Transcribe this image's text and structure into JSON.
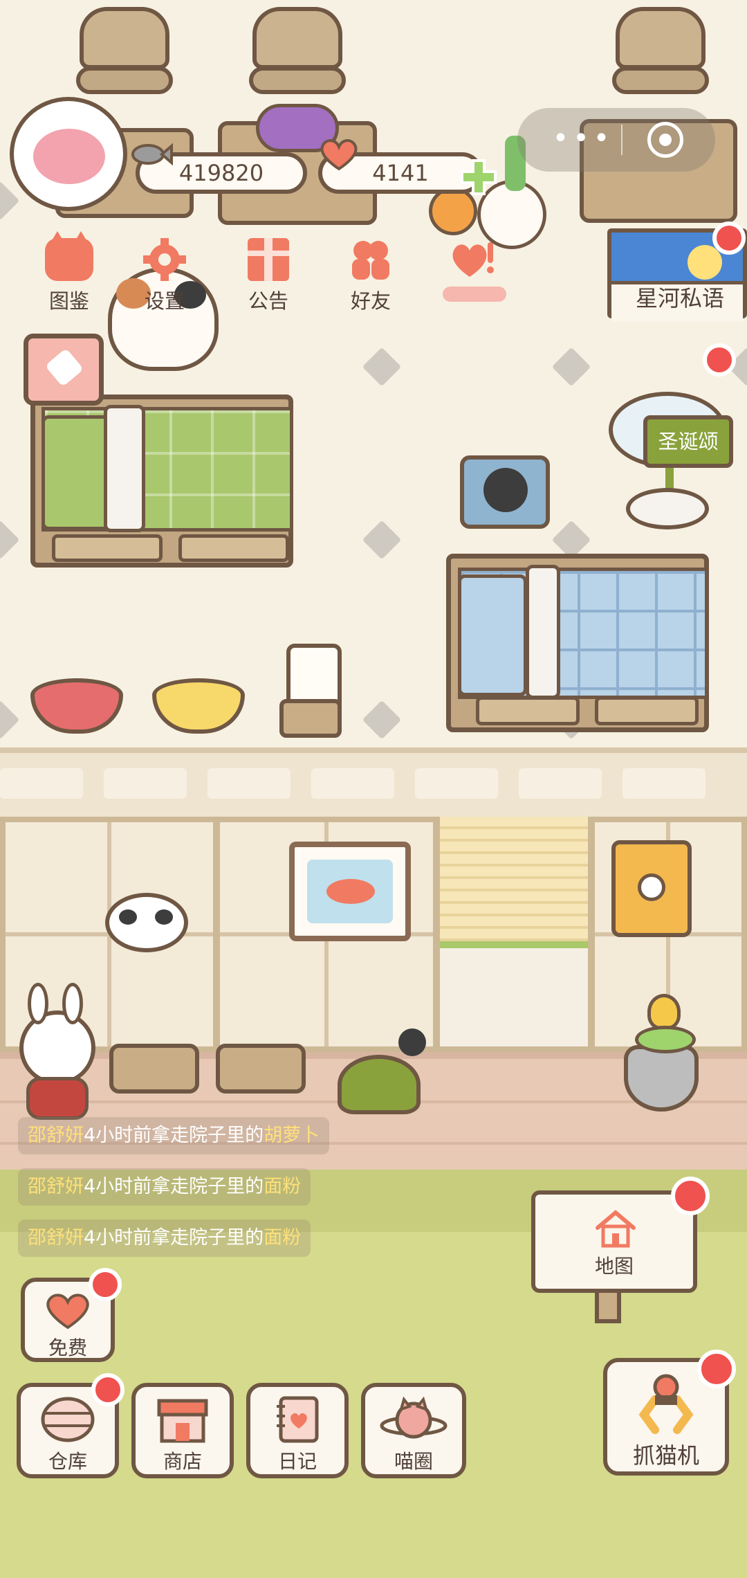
{
  "hud": {
    "avatar_icon": "cat-avatar-icon",
    "coins": {
      "value": "419820",
      "icon": "fish-icon"
    },
    "hearts": {
      "value": "4141",
      "icon": "heart-icon"
    },
    "add_icon": "plus-icon",
    "capsule": {
      "more_icon": "more-dots-icon",
      "close_icon": "target-close-icon"
    }
  },
  "top_menu": [
    {
      "label": "图鉴",
      "icon": "cat-face-icon"
    },
    {
      "label": "设置",
      "icon": "gear-icon"
    },
    {
      "label": "公告",
      "icon": "gift-icon"
    },
    {
      "label": "好友",
      "icon": "friends-icon"
    },
    {
      "label": "",
      "icon": "alert-heart-icon"
    }
  ],
  "signs": {
    "galaxy": "星河私语",
    "carol": "圣诞颂"
  },
  "feed": [
    {
      "name": "邵舒妍",
      "text": "4小时前拿走院子里的",
      "item": "胡萝卜"
    },
    {
      "name": "邵舒妍",
      "text": "4小时前拿走院子里的",
      "item": "面粉"
    },
    {
      "name": "邵舒妍",
      "text": "4小时前拿走院子里的",
      "item": "面粉"
    }
  ],
  "buttons": {
    "free": {
      "label": "免费",
      "icon": "heart-icon"
    },
    "warehouse": {
      "label": "仓库",
      "icon": "barrel-icon"
    },
    "shop": {
      "label": "商店",
      "icon": "shop-icon"
    },
    "diary": {
      "label": "日记",
      "icon": "diary-icon"
    },
    "circle": {
      "label": "喵圈",
      "icon": "planet-cat-icon"
    },
    "map": {
      "label": "地图",
      "icon": "house-icon"
    },
    "claw": {
      "label": "抓猫机",
      "icon": "claw-icon"
    }
  },
  "colors": {
    "accent": "#f17a62",
    "badge": "#f0524f",
    "outline": "#6f5744",
    "grass": "#d5da8c"
  }
}
